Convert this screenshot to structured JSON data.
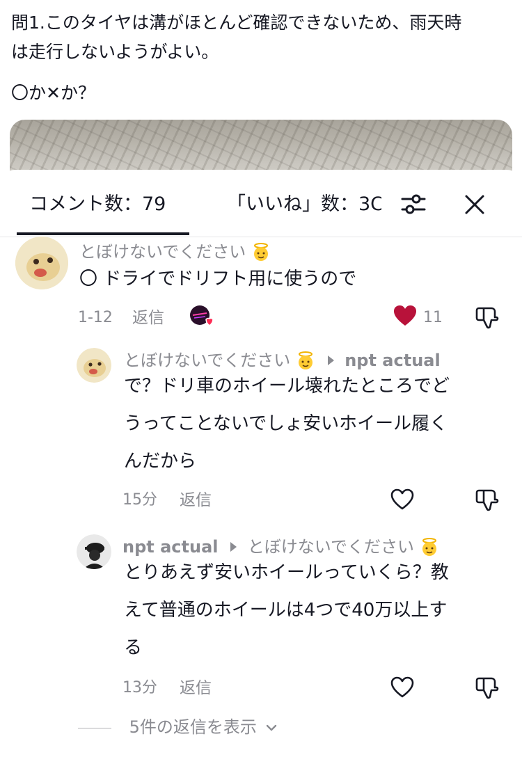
{
  "post": {
    "text_line1": "問1.このタイヤは溝がほとんど確認できないため、雨天時",
    "text_line2": "は走行しないようがよい。",
    "question": "〇か✕か？"
  },
  "panel": {
    "comments_tab": "コメント数：79",
    "likes_tab": "「いいね」数：3C",
    "filter_icon": "sliders-icon",
    "close_icon": "close-icon"
  },
  "comments": [
    {
      "username": "とぼけないでください",
      "text": "〇 ドライでドリフト用に使うので",
      "date": "1-12",
      "reply_label": "返信",
      "like_count": "11",
      "liked": true
    }
  ],
  "replies": [
    {
      "username": "とぼけないでください",
      "reply_to": "npt actual",
      "text_line1": "で？ドリ車のホイール壊れたところでど",
      "text_line2": "うってことないでしょ安いホイール履く",
      "text_line3": "んだから",
      "time": "15分",
      "reply_label": "返信"
    },
    {
      "username": "npt actual",
      "reply_to": "とぼけないでください",
      "text_line1": "とりあえず安いホイールっていくら？教",
      "text_line2": "えて普通のホイールは4つで40万以上す",
      "text_line3": "る",
      "time": "13分",
      "reply_label": "返信"
    }
  ],
  "view_more_replies": "5件の返信を表示",
  "colors": {
    "heart_liked": "#b8123a",
    "text_primary": "#161823",
    "text_secondary": "#8a8b91"
  }
}
